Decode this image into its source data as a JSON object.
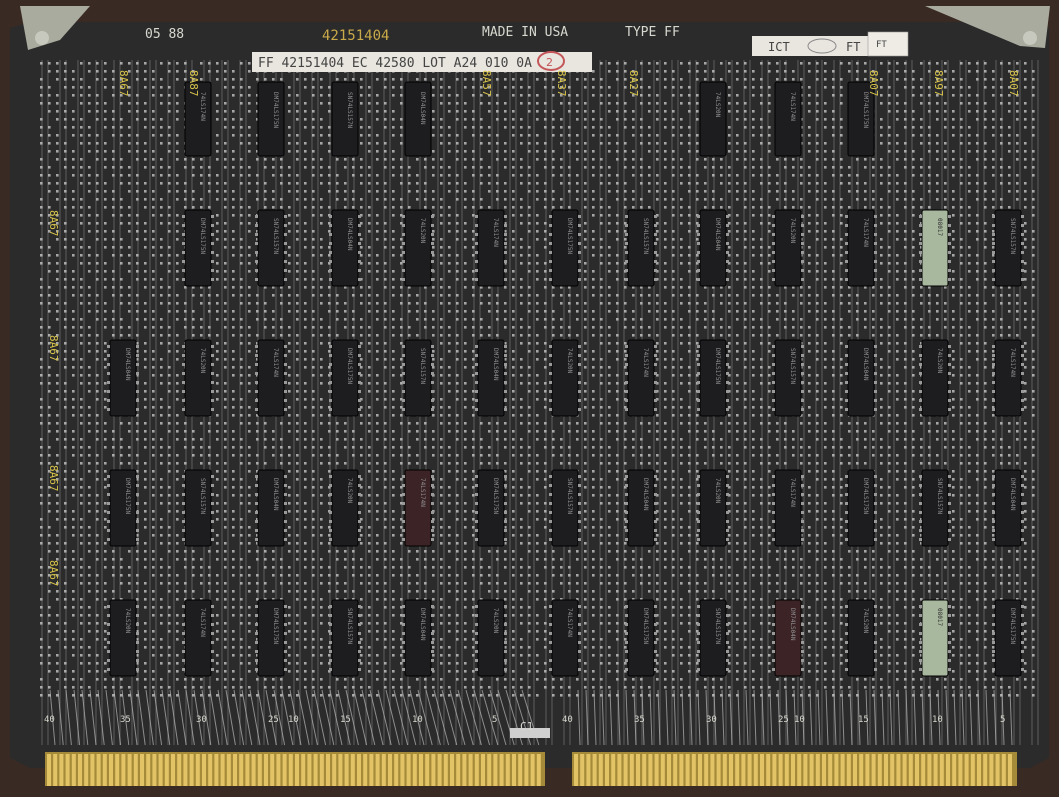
{
  "board": {
    "part_number": "42151404",
    "made_in": "MADE IN USA",
    "type": "TYPE FF",
    "topleft_code": "05 88",
    "label_text": "FF 42151404   EC 42580 LOT A24 010 0A",
    "label_stamp": "2",
    "ict_label": "ICT",
    "ft_label": "FT",
    "ft_sub": "FT"
  },
  "colors": {
    "board": "#2b2b2b",
    "frame": "#3a2a24",
    "trace": "#cfcfcf",
    "pad": "#e8e8e8",
    "chip": "#1b1b1d",
    "gold": "#c9a94a",
    "silk": "#d8d8d0",
    "yellow": "#d7c34a"
  },
  "top_row_labels": [
    "8A67",
    "8A87",
    "8A57",
    "8A37",
    "8A27",
    "8A07",
    "8A97",
    "8A07"
  ],
  "left_labels": [
    "8A67",
    "8A67",
    "8A67",
    "8A67"
  ],
  "bottom_pin_numbers": [
    "40",
    "35",
    "30",
    "25",
    "10",
    "15",
    "10",
    "5",
    "40",
    "35",
    "30",
    "25",
    "10",
    "15",
    "10",
    "5"
  ],
  "bottom_connector_label": "C1",
  "chip_marks": [
    "74LS174N",
    "DM74LS175N",
    "SN74LS157N",
    "DM74LS04N",
    "74LS20N"
  ],
  "green_chip_text": [
    "16",
    "08017",
    "C13319",
    "9",
    "8"
  ]
}
